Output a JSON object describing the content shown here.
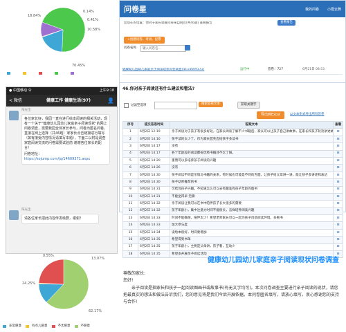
{
  "pie_top": {
    "labels": [
      "18.84%",
      "0.14%",
      "0.41%",
      "10.58%",
      "70.45%"
    ],
    "slices": [
      {
        "pct": 70.45,
        "color": "#4cc94c"
      },
      {
        "pct": 18.84,
        "color": "#3fa7d6"
      },
      {
        "pct": 0.14,
        "color": "#f2c230"
      },
      {
        "pct": 0.41,
        "color": "#e05050"
      },
      {
        "pct": 10.58,
        "color": "#a070d0"
      }
    ]
  },
  "phone": {
    "status_left": "● 中国移动 令",
    "status_right": "上午9:18",
    "back_label": "< 微信",
    "chat_title": "健康工作 健康生活(97)",
    "sender1": "阳光宝",
    "message1": "各位家长好，我园一直在进行绘本阅读的相关活动，现有一个关于\"健康幼儿园幼儿家庭亲子阅读现状\"的网上问卷调查，需要我园全体家长参与，问卷为匿名问卷，直接在网上选择（共46题）家家长点击链接进行填写（如有接受内容情况请填写本题），下面二以附是调查家庭阅读交流的问卷需要试验前 谢谢各位家长的配合！",
    "link_label": "问卷地址：",
    "link_url": "https://sojump.com/jq/14609371.aspx",
    "sender2": "阳光宝",
    "message2": "请各位家长把此内容传发级群，谢谢！"
  },
  "web": {
    "logo": "问卷星",
    "nav_items": [
      "我的问卷",
      "小霞云舞"
    ],
    "breadcrumb": "您现在的位置：你对于家长调查问卷来自网页(共46题) 查看报告",
    "report_button": "查看报告",
    "create_button": "+创建问卷、考试、投票",
    "search_label": "问卷名称",
    "search_placeholder": "输入问卷名...",
    "survey_row_title": "健康幼儿园幼儿家庭亲子阅读现状问卷调查(ID:14609371)",
    "survey_row_status": "运行中",
    "survey_row_count_label": "答卷：727",
    "survey_row_count": "727",
    "survey_row_date": "6月21日 08:53",
    "question": "46.你对亲子阅读还有什么建议和看法?",
    "filter_label": "过滤空选项",
    "view_text_button": "搜索答卷文本",
    "keyword_button": "获取关键字",
    "export_button": "导出到Excel",
    "export_link": "以文本形式导出所有答卷",
    "columns": [
      "序号",
      "提交答卷时间",
      "答案文本",
      "查看"
    ],
    "rows": [
      {
        "no": "1",
        "time": "6月2日 12:19",
        "text": "亲子阅读对于孩子有很多好处，在家长阅读了解不少书籍后，家长可以让孩子自己讲故事，在家长和孩子轮流讲述故事情节"
      },
      {
        "no": "2",
        "time": "6月2日 14:16",
        "text": "孩子读的太少了，作为家长首先应给孩子多读书"
      },
      {
        "no": "3",
        "time": "6月2日 14:17",
        "text": "没有"
      },
      {
        "no": "4",
        "time": "6月2日 14:17",
        "text": "各个年龄段的阅读都很优秀书籍还不太了解。"
      },
      {
        "no": "5",
        "time": "6月2日 14:20",
        "text": "重而可以多培养孩子阅读的兴趣"
      },
      {
        "no": "6",
        "time": "6月2日 14:26",
        "text": "没有"
      },
      {
        "no": "7",
        "time": "6月2日 14:30",
        "text": "孩子阅读不同是亲情与书籍的关系，有时候也可能是不同的方面，让孩子给父母讲一讲，能让孩子多讲述和表达"
      },
      {
        "no": "8",
        "time": "6月2日 14:30",
        "text": "孩子幼师推荐的书"
      },
      {
        "no": "9",
        "time": "6月2日 14:31",
        "text": "可结合孩子兴趣，不知道怎么可以去有趣准有孩子年龄的图书"
      },
      {
        "no": "10",
        "time": "6月2日 14:31",
        "text": "不能坐得早 无聊"
      },
      {
        "no": "11",
        "time": "6月2日 14:32",
        "text": "亲子阅读让我可以在书中陪伴孩子长大很多的需要"
      },
      {
        "no": "12",
        "time": "6月2日 14:32",
        "text": "孩子年龄小，集中注意力时间不能很长，怎样培养阅读兴趣"
      },
      {
        "no": "13",
        "time": "6月2日 14:33",
        "text": "时间不能确保，陪伴太少！希望老师家长可以一起为孩子创造阅读环境，多看书"
      },
      {
        "no": "14",
        "time": "6月2日 14:33",
        "text": "加大参与度"
      },
      {
        "no": "15",
        "time": "6月2日 14:34",
        "text": "读绘本很好，时间要增加"
      },
      {
        "no": "16",
        "time": "6月2日 14:35",
        "text": "希望得到书单"
      },
      {
        "no": "17",
        "time": "6月2日 14:35",
        "text": "孩子年龄小，主要是父母讲，孩子看，互动少"
      },
      {
        "no": "18",
        "time": "6月2日 14:35",
        "text": "希望多开展亲子阅读活动"
      }
    ],
    "view_icon_text": "⊞"
  },
  "pie_bottom": {
    "labels": [
      "0.55%",
      "13.07%",
      "24.25%",
      "62.17%"
    ],
    "slices": [
      {
        "pct": 62.17,
        "color": "#a0d070"
      },
      {
        "pct": 13.07,
        "color": "#3fa7d6"
      },
      {
        "pct": 0.55,
        "color": "#f2c230"
      },
      {
        "pct": 24.25,
        "color": "#e05050"
      }
    ],
    "legend": [
      "非常愿意",
      "有点儿愿意",
      "不太愿意",
      "不愿意"
    ]
  },
  "survey": {
    "title": "健康幼儿园幼儿家庭亲子阅读现状问卷调查",
    "greeting": "尊敬的家长:",
    "hello": "您好!",
    "body": "亲子阅读是指家长和孩子一起阅读图画书或故事书(有无文字均可)。本次问卷调查主要进行亲子阅读的现状，请您把最真实的想法和做法告诉我们，您的意见将是我们今后开展依据。本问卷匿名填写，请放心填写。衷心感谢您的支持与合作!"
  },
  "colors": {
    "header_blue": "#2a6fb8",
    "orange": "#f08c2c",
    "title_blue": "#1e90ff"
  }
}
